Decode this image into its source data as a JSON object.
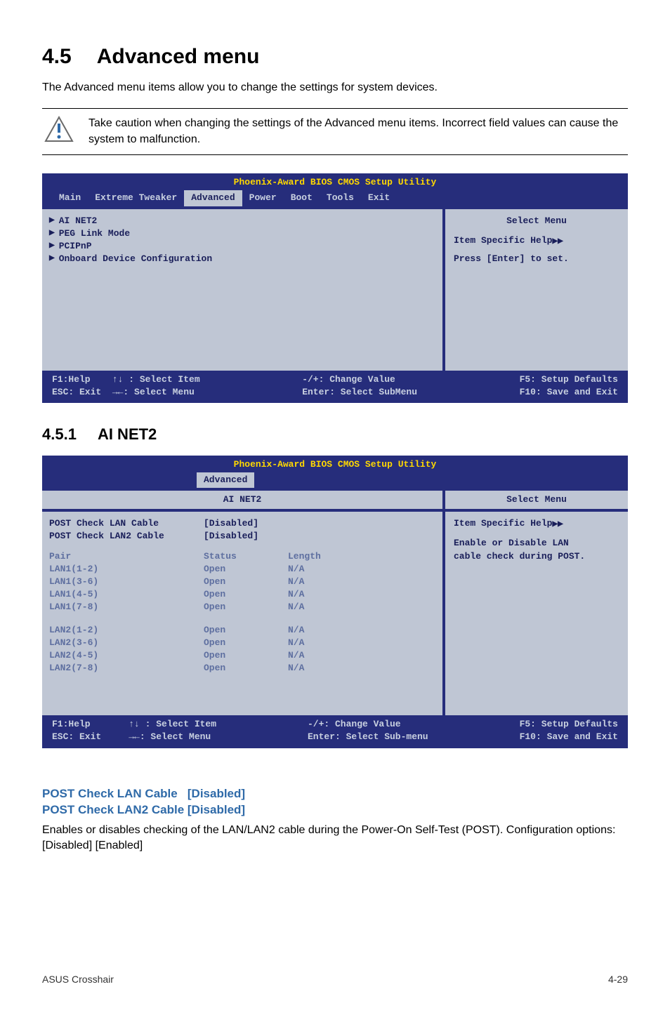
{
  "section": {
    "number": "4.5",
    "title": "Advanced menu"
  },
  "intro": "The Advanced menu items allow you to change the settings for system devices.",
  "notice": "Take caution when changing the settings of the Advanced menu items. Incorrect field values can cause the system to malfunction.",
  "bios1": {
    "title": "Phoenix-Award BIOS CMOS Setup Utility",
    "menubar": [
      "Main",
      "Extreme Tweaker",
      "Advanced",
      "Power",
      "Boot",
      "Tools",
      "Exit"
    ],
    "active_tab": "Advanced",
    "left_items": [
      "AI NET2",
      "PEG Link Mode",
      "PCIPnP",
      "Onboard Device Configuration"
    ],
    "right": {
      "select_menu": "Select Menu",
      "help": "Item Specific Help",
      "hint": "Press [Enter] to set."
    },
    "footer": {
      "c1a": "F1:Help    ↑↓ : Select Item",
      "c1b": "ESC: Exit  →←: Select Menu",
      "c2a": "-/+: Change Value",
      "c2b": "Enter: Select SubMenu",
      "c3a": "F5: Setup Defaults",
      "c3b": "F10: Save and Exit"
    }
  },
  "subsection": {
    "number": "4.5.1",
    "title": "AI NET2"
  },
  "bios2": {
    "title": "Phoenix-Award BIOS CMOS Setup Utility",
    "active_tab": "Advanced",
    "subhead_left": "AI NET2",
    "subhead_right": "Select Menu",
    "post1": {
      "label": "POST Check LAN Cable",
      "value": "[Disabled]"
    },
    "post2": {
      "label": "POST Check LAN2 Cable",
      "value": "[Disabled]"
    },
    "cols": {
      "c1": "Pair",
      "c2": "Status",
      "c3": "Length"
    },
    "lan1": [
      {
        "pair": "LAN1(1-2)",
        "status": "Open",
        "length": "N/A"
      },
      {
        "pair": "LAN1(3-6)",
        "status": "Open",
        "length": "N/A"
      },
      {
        "pair": "LAN1(4-5)",
        "status": "Open",
        "length": "N/A"
      },
      {
        "pair": "LAN1(7-8)",
        "status": "Open",
        "length": "N/A"
      }
    ],
    "lan2": [
      {
        "pair": "LAN2(1-2)",
        "status": "Open",
        "length": "N/A"
      },
      {
        "pair": "LAN2(3-6)",
        "status": "Open",
        "length": "N/A"
      },
      {
        "pair": "LAN2(4-5)",
        "status": "Open",
        "length": "N/A"
      },
      {
        "pair": "LAN2(7-8)",
        "status": "Open",
        "length": "N/A"
      }
    ],
    "right": {
      "help": "Item Specific Help",
      "hint1": "Enable or Disable LAN",
      "hint2": "cable check during POST."
    },
    "footer": {
      "c1a": "F1:Help       ↑↓ : Select Item",
      "c1b": "ESC: Exit     →←: Select Menu",
      "c2a": "-/+: Change Value",
      "c2b": "Enter: Select Sub-menu",
      "c3a": "F5: Setup Defaults",
      "c3b": "F10: Save and Exit"
    }
  },
  "option": {
    "title1": "POST Check LAN Cable   [Disabled]",
    "title2": "POST Check LAN2 Cable [Disabled]",
    "body": "Enables or disables checking of the LAN/LAN2 cable during the Power-On Self-Test (POST). Configuration options: [Disabled] [Enabled]"
  },
  "footer": {
    "left": "ASUS Crosshair",
    "right": "4-29"
  }
}
